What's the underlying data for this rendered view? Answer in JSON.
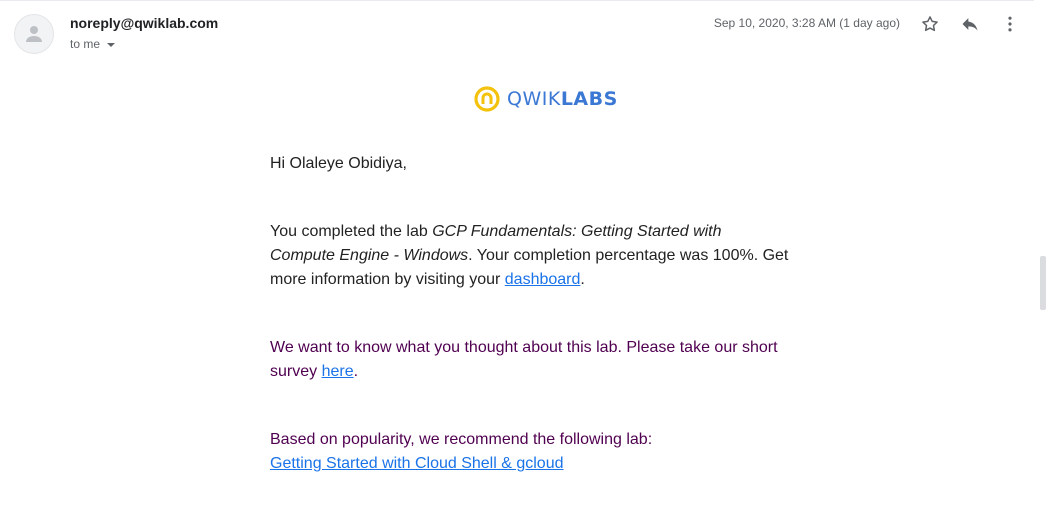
{
  "email": {
    "sender": "noreply@qwiklab.com",
    "recipient_label": "to me",
    "date": "Sep 10, 2020, 3:28 AM (1 day ago)"
  },
  "icons": {
    "avatar": "person-icon",
    "star": "star-icon",
    "reply": "reply-icon",
    "more": "more-vert-icon",
    "logo": "qwiklabs-logo-icon"
  },
  "logo": {
    "part1": "QWIK",
    "part2": "LABS"
  },
  "message": {
    "greeting": "Hi Olaleye Obidiya,",
    "p1_prefix": "You completed the lab ",
    "p1_lab_name": "GCP Fundamentals: Getting Started with Compute Engine - Windows",
    "p1_middle": ". Your completion percentage was 100%. Get more information by visiting your ",
    "p1_link": "dashboard",
    "p1_suffix": ".",
    "p2_prefix": "We want to know what you thought about this lab. Please take our short survey ",
    "p2_link": "here",
    "p2_suffix": ".",
    "p3_text": "Based on popularity, we recommend the following lab:",
    "p3_link": "Getting Started with Cloud Shell & gcloud"
  },
  "colors": {
    "link": "#1a73e8",
    "quoted_text": "#500050",
    "logo_blue": "#3b78d4",
    "logo_yellow": "#f4c20d"
  }
}
